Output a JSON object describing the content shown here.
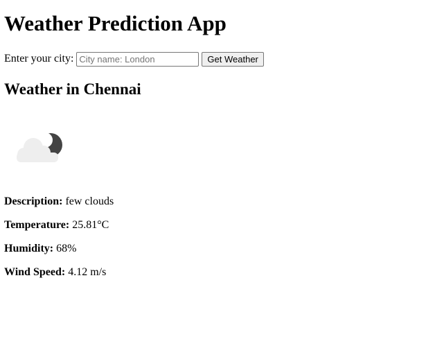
{
  "header": {
    "title": "Weather Prediction App"
  },
  "search": {
    "label": "Enter your city:",
    "value": "",
    "placeholder": "City name: London",
    "button_label": "Get Weather"
  },
  "weather": {
    "heading": "Weather in Chennai",
    "icon": "few-clouds-night-icon",
    "description_label": "Description:",
    "description_value": "few clouds",
    "temperature_label": "Temperature:",
    "temperature_value": "25.81°C",
    "humidity_label": "Humidity:",
    "humidity_value": "68%",
    "wind_label": "Wind Speed:",
    "wind_value": "4.12 m/s"
  },
  "colors": {
    "cloud": "#eeeeee",
    "moon": "#444444"
  }
}
